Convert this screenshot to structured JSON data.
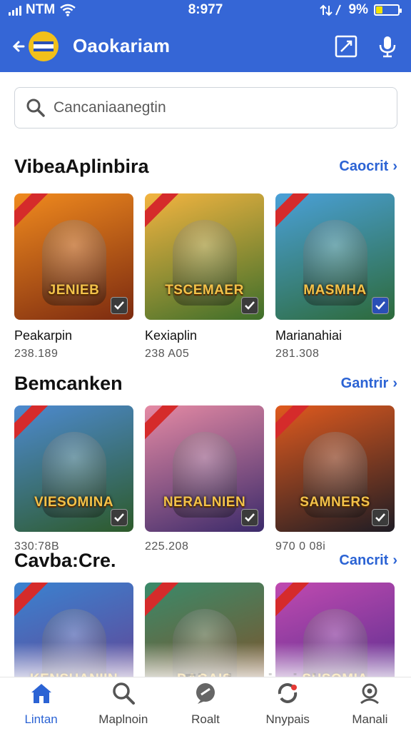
{
  "status_bar": {
    "carrier": "NTM",
    "time": "8:977",
    "battery_text": "9%",
    "battery_level": 0.3
  },
  "app_bar": {
    "title": "Oaokariam"
  },
  "search": {
    "placeholder": "Cancaniaanegtin"
  },
  "sections": [
    {
      "title": "VibeaAplinbira",
      "see_all": "Caocrit",
      "items": [
        {
          "name": "Peakarpin",
          "meta": "238.189",
          "thumb_title": "JENIEB",
          "colors": [
            "#f08a1e",
            "#7b2a10"
          ]
        },
        {
          "name": "Kexiaplin",
          "meta": "238 A05",
          "thumb_title": "TSCEMAER",
          "colors": [
            "#f3b440",
            "#3d6e2a"
          ]
        },
        {
          "name": "Marianahiai",
          "meta": "281.308",
          "thumb_title": "MASMHA",
          "colors": [
            "#4aa0d8",
            "#2d6a3a"
          ]
        }
      ]
    },
    {
      "title": "Bemcanken",
      "see_all": "Gantrir",
      "items": [
        {
          "name": "",
          "meta": "330:78B",
          "thumb_title": "VIESOMINA",
          "colors": [
            "#4d8ad0",
            "#2d5a2a"
          ]
        },
        {
          "name": "",
          "meta": "225.208",
          "thumb_title": "NERALNIEN",
          "colors": [
            "#e58aa4",
            "#3b2a6a"
          ]
        },
        {
          "name": "",
          "meta": "970 0 08i",
          "thumb_title": "SAMNERS",
          "colors": [
            "#e05a1e",
            "#1e1c24"
          ]
        }
      ]
    },
    {
      "title": "Cavba:Cre.",
      "see_all": "Cancrit",
      "items": [
        {
          "name": "",
          "meta": "",
          "thumb_title": "KENSHANIIN",
          "colors": [
            "#3a82d0",
            "#6a3a8a"
          ]
        },
        {
          "name": "",
          "meta": "",
          "thumb_title": "DAGAIS",
          "colors": [
            "#3a8a6a",
            "#8a4a20"
          ]
        },
        {
          "name": "",
          "meta": "",
          "thumb_title": "SHSOMIA",
          "colors": [
            "#c04ab0",
            "#4a2a8a"
          ]
        }
      ]
    }
  ],
  "watermark": "Fivaluruiminiyo",
  "nav": [
    {
      "label": "Lintan",
      "icon": "home-icon",
      "active": true
    },
    {
      "label": "Maplnoin",
      "icon": "search-icon",
      "active": false
    },
    {
      "label": "Roalt",
      "icon": "chat-icon",
      "active": false
    },
    {
      "label": "Nnypais",
      "icon": "refresh-icon",
      "active": false
    },
    {
      "label": "Manali",
      "icon": "profile-icon",
      "active": false
    }
  ],
  "colors": {
    "brand": "#3566d6",
    "link": "#2b63d4",
    "battery": "#f4e400"
  }
}
